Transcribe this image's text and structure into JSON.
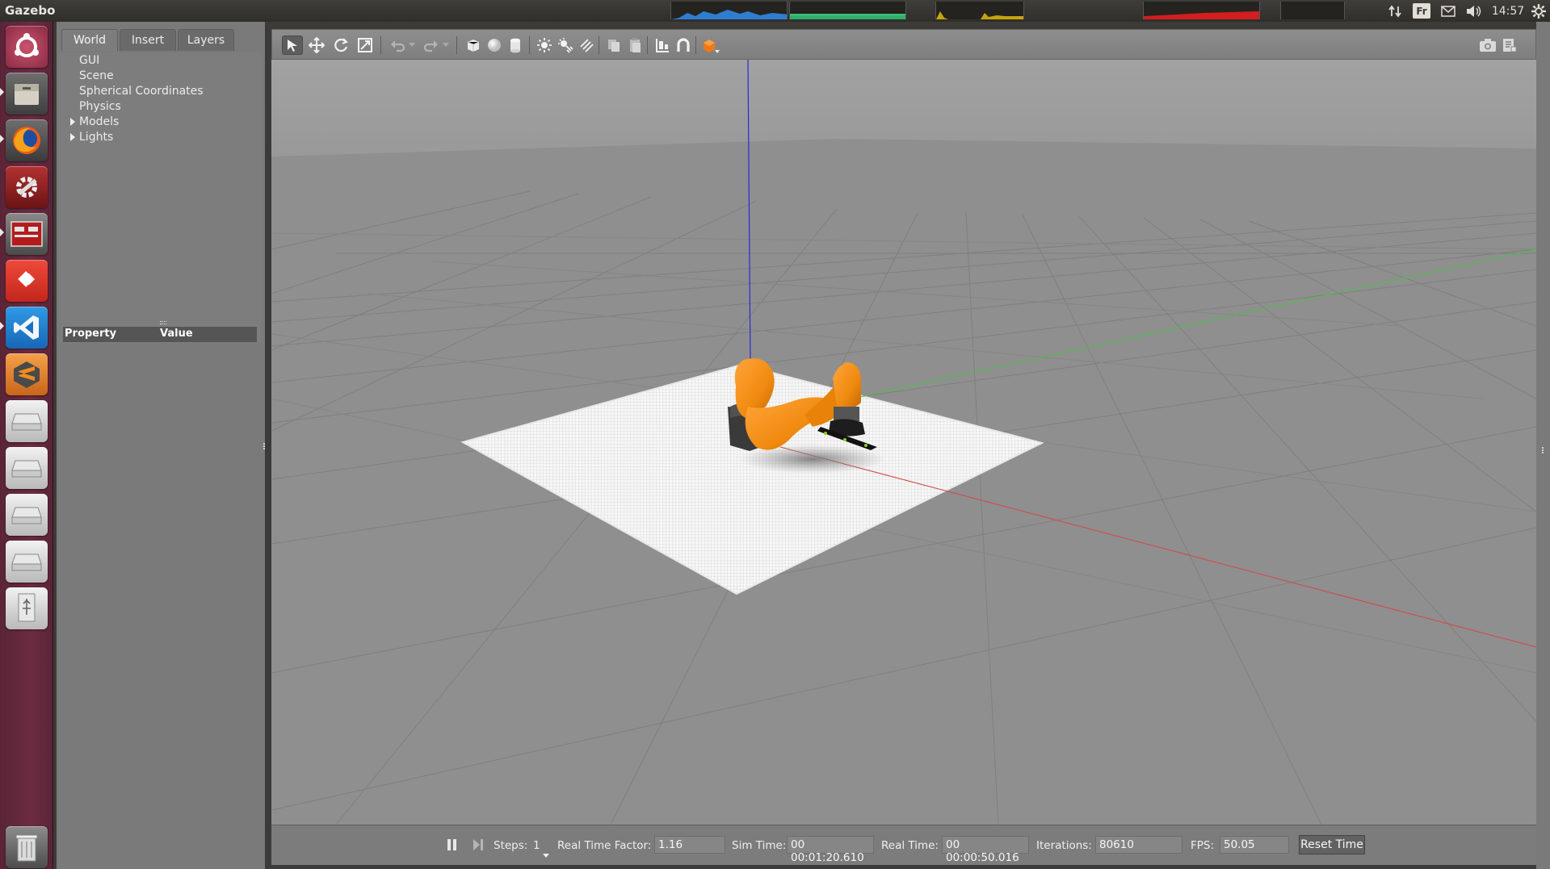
{
  "topbar": {
    "app_title": "Gazebo",
    "clock": "14:57",
    "keyboard_layout": "Fr",
    "icons": [
      "network-icon",
      "keyboard-icon",
      "mail-icon",
      "volume-icon",
      "settings-icon"
    ]
  },
  "launcher": {
    "items": [
      "ubuntu-dash",
      "files",
      "firefox",
      "system-tools",
      "gazebo-app",
      "anydesk",
      "vscode",
      "sublime-text",
      "drive-1",
      "drive-2",
      "drive-3",
      "drive-4",
      "usb-drive",
      "trash"
    ]
  },
  "left_panel": {
    "tabs": [
      "World",
      "Insert",
      "Layers"
    ],
    "active_tab": "World",
    "tree_items": [
      {
        "label": "GUI",
        "expandable": false
      },
      {
        "label": "Scene",
        "expandable": false
      },
      {
        "label": "Spherical Coordinates",
        "expandable": false
      },
      {
        "label": "Physics",
        "expandable": false
      },
      {
        "label": "Models",
        "expandable": true
      },
      {
        "label": "Lights",
        "expandable": true
      }
    ],
    "property_header": {
      "property": "Property",
      "value": "Value"
    }
  },
  "toolbar": {
    "tools": [
      "select-arrow-icon",
      "translate-icon",
      "rotate-icon",
      "scale-icon",
      "undo-icon",
      "redo-icon",
      "box-icon",
      "sphere-icon",
      "cylinder-icon",
      "point-light-icon",
      "spot-light-icon",
      "directional-light-icon",
      "copy-icon",
      "paste-icon",
      "align-icon",
      "magnet-icon",
      "view-angle-icon",
      "screenshot-icon",
      "log-icon"
    ]
  },
  "bottom_bar": {
    "steps_label": "Steps:",
    "steps_value": "1",
    "rtf_label": "Real Time Factor:",
    "rtf_value": "1.16",
    "sim_time_label": "Sim Time:",
    "sim_time_value": "00 00:01:20.610",
    "real_time_label": "Real Time:",
    "real_time_value": "00 00:00:50.016",
    "iterations_label": "Iterations:",
    "iterations_value": "80610",
    "fps_label": "FPS:",
    "fps_value": "50.05",
    "reset_label": "Reset Time"
  },
  "colors": {
    "launcher": "#6c2c42",
    "panel": "#7a7a7a",
    "viewport_sky": "#a3a3a3",
    "ground": "#8f8f8f",
    "robot": "#f08a10",
    "x_axis": "#d24a4a",
    "y_axis": "#4cbf4c",
    "z_axis": "#2a2ad8"
  }
}
